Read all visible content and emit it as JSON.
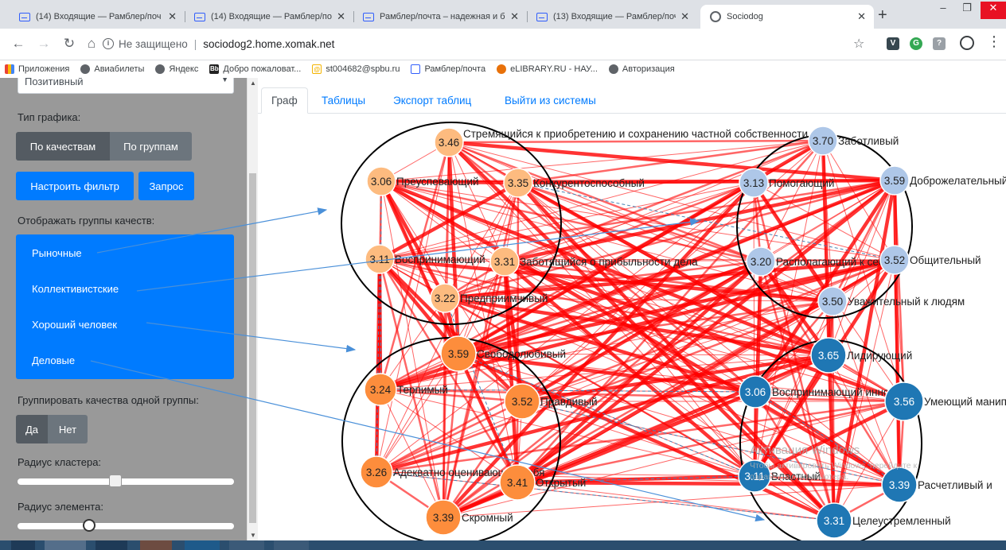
{
  "browser": {
    "tabs": [
      {
        "title": "(14) Входящие — Рамблер/поч",
        "icon": "mail-icon"
      },
      {
        "title": "(14) Входящие — Рамблер/поч",
        "icon": "mail-icon"
      },
      {
        "title": "Рамблер/почта – надежная и б",
        "icon": "mail-icon"
      },
      {
        "title": "(13) Входящие — Рамблер/поч",
        "icon": "mail-icon"
      },
      {
        "title": "Sociodog",
        "icon": "globe-icon",
        "active": true
      }
    ],
    "new_tab": "+",
    "address_security": "Не защищено",
    "address_url": "sociodog2.home.xomak.net",
    "bookmarks": [
      {
        "label": "Приложения",
        "icon": "apps-icon"
      },
      {
        "label": "Авиабилеты",
        "icon": "globe-icon"
      },
      {
        "label": "Яндекс",
        "icon": "globe-icon"
      },
      {
        "label": "Добро пожаловат...",
        "icon": "bb-icon"
      },
      {
        "label": "st004682@spbu.ru",
        "icon": "email-icon"
      },
      {
        "label": "Рамблер/почта",
        "icon": "mail-icon"
      },
      {
        "label": "eLIBRARY.RU - НАУ...",
        "icon": "elibrary-icon"
      },
      {
        "label": "Авторизация",
        "icon": "globe-icon"
      }
    ]
  },
  "sidebar": {
    "sentiment_select": "Позитивный",
    "chart_type_label": "Тип графика:",
    "chart_type_options": [
      "По качествам",
      "По группам"
    ],
    "filter_button": "Настроить фильтр",
    "query_button": "Запрос",
    "show_groups_label": "Отображать группы качеств:",
    "groups": [
      "Рыночные",
      "Коллективистские",
      "Хороший человек",
      "Деловые"
    ],
    "group_same_label": "Группировать качества одной группы:",
    "group_same_options": [
      "Да",
      "Нет"
    ],
    "cluster_radius_label": "Радиус кластера:",
    "cluster_radius_value": 0.45,
    "element_radius_label": "Радиус элемента:",
    "element_radius_value": 0.32
  },
  "main": {
    "tabs": [
      "Граф",
      "Таблицы",
      "Экспорт таблиц",
      "Выйти из системы"
    ],
    "active_tab": "Граф"
  },
  "colors": {
    "market": "#fdbb7f",
    "collectivist": "#aec7e8",
    "good_person": "#fd8d3c",
    "business": "#1f77b4",
    "edge": "#ff0000",
    "dashed": "#4682b4",
    "primary": "#007bff"
  },
  "graph": {
    "nodes": [
      {
        "id": "n1",
        "value": "3.46",
        "label": "Стремящийся к приобретению и сохранению частной собственности",
        "group": "market"
      },
      {
        "id": "n2",
        "value": "3.06",
        "label": "Преуспевающий",
        "group": "market"
      },
      {
        "id": "n3",
        "value": "3.35",
        "label": "Конкурентоспособный",
        "group": "market"
      },
      {
        "id": "n4",
        "value": "3.11",
        "label": "Воспринимающий",
        "group": "market"
      },
      {
        "id": "n5",
        "value": "3.31",
        "label": "Заботящийся о прибыльности дела",
        "group": "market"
      },
      {
        "id": "n6",
        "value": "3.22",
        "label": "Предприимчивый",
        "group": "market"
      },
      {
        "id": "n7",
        "value": "3.70",
        "label": "Заботливый",
        "group": "collectivist"
      },
      {
        "id": "n8",
        "value": "3.13",
        "label": "Помогающий",
        "group": "collectivist"
      },
      {
        "id": "n9",
        "value": "3.59",
        "label": "Доброжелательный",
        "group": "collectivist"
      },
      {
        "id": "n10",
        "value": "3.20",
        "label": "Располагающий к себе",
        "group": "collectivist"
      },
      {
        "id": "n11",
        "value": "3.52",
        "label": "Общительный",
        "group": "collectivist"
      },
      {
        "id": "n12",
        "value": "3.50",
        "label": "Уважительный к людям",
        "group": "collectivist"
      },
      {
        "id": "n13",
        "value": "3.59",
        "label": "Свободолюбивый",
        "group": "good_person"
      },
      {
        "id": "n14",
        "value": "3.24",
        "label": "Терпимый",
        "group": "good_person"
      },
      {
        "id": "n15",
        "value": "3.52",
        "label": "Правдивый",
        "group": "good_person"
      },
      {
        "id": "n16",
        "value": "3.26",
        "label": "Адекватно оценивающий себя",
        "group": "good_person"
      },
      {
        "id": "n17",
        "value": "3.41",
        "label": "Открытый",
        "group": "good_person"
      },
      {
        "id": "n18",
        "value": "3.39",
        "label": "Скромный",
        "group": "good_person"
      },
      {
        "id": "n19",
        "value": "3.65",
        "label": "Лидирующий",
        "group": "business"
      },
      {
        "id": "n20",
        "value": "3.06",
        "label": "Воспринимающий инновации",
        "group": "business"
      },
      {
        "id": "n21",
        "value": "3.56",
        "label": "Умеющий манипулировать",
        "group": "business"
      },
      {
        "id": "n22",
        "value": "3.11",
        "label": "Властный",
        "group": "business"
      },
      {
        "id": "n23",
        "value": "3.39",
        "label": "Расчетливый и",
        "group": "business"
      },
      {
        "id": "n24",
        "value": "3.31",
        "label": "Целеустремленный",
        "group": "business"
      }
    ],
    "watermark_title": "Активация Windows",
    "watermark_sub": "Чтобы активировать Windows, перейдите к параметрам компьютера."
  }
}
